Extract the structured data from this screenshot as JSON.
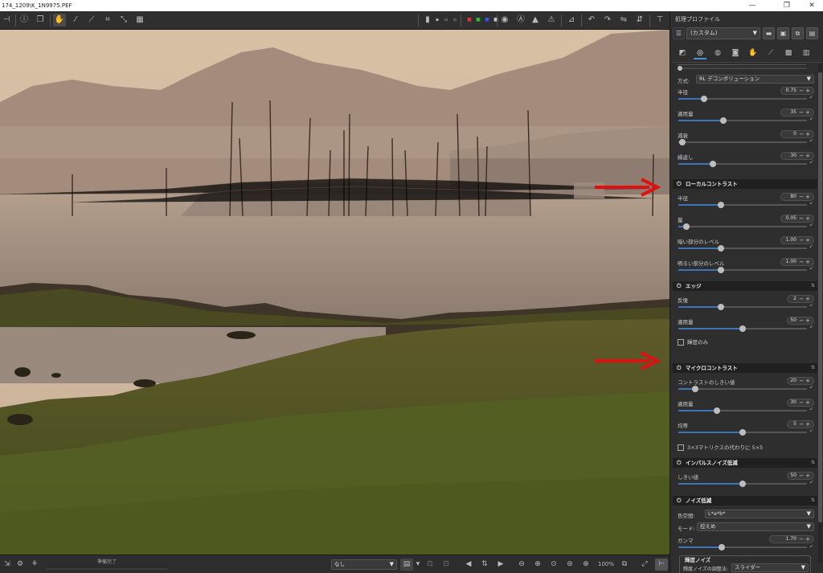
{
  "window": {
    "title": "174_1209\\K_1N9975.PEF",
    "minimize": "—",
    "maximize": "❐",
    "close": "✕"
  },
  "toolbar": {
    "icons": [
      "panel-toggle-icon",
      "info-icon",
      "compare-icon",
      "hand-icon",
      "color-picker-icon",
      "straighten-icon",
      "crop-icon",
      "resize-icon",
      "perspective-icon",
      "preview-bg-black-icon",
      "preview-bg-white-icon",
      "channel-rgb-icon",
      "focus-mask-icon",
      "shadow-clip-icon",
      "highlight-clip-icon",
      "histogram-icon",
      "rotate-left-icon",
      "rotate-right-icon",
      "flip-h-icon",
      "flip-v-icon",
      "straighten-tool-icon"
    ]
  },
  "panel": {
    "title": "処理プロファイル",
    "profile_value": "(カスタム)",
    "sections": {
      "sharpen": {
        "method_label": "方式:",
        "method_value": "RL デコンボリューション",
        "rows": [
          {
            "label": "半径",
            "value": "0.75",
            "pos": 0.2
          },
          {
            "label": "適用量",
            "value": "35",
            "pos": 0.35
          },
          {
            "label": "減衰",
            "value": "0",
            "pos": 0.03
          },
          {
            "label": "繰返し",
            "value": "30",
            "pos": 0.27
          }
        ]
      },
      "local_contrast": {
        "title": "ローカルコントラスト",
        "rows": [
          {
            "label": "半径",
            "value": "80",
            "pos": 0.33
          },
          {
            "label": "量",
            "value": "0.05",
            "pos": 0.06
          },
          {
            "label": "暗い部分のレベル",
            "value": "1.00",
            "pos": 0.33
          },
          {
            "label": "明るい部分のレベル",
            "value": "1.00",
            "pos": 0.33
          }
        ]
      },
      "edge": {
        "title": "エッジ",
        "rows": [
          {
            "label": "反復",
            "value": "2",
            "pos": 0.33
          },
          {
            "label": "適用量",
            "value": "50",
            "pos": 0.5
          }
        ],
        "checkbox_label": "輝度のみ"
      },
      "micro_contrast": {
        "title": "マイクロコントラスト",
        "rows": [
          {
            "label": "コントラストのしきい値",
            "value": "20",
            "pos": 0.13
          },
          {
            "label": "適用量",
            "value": "30",
            "pos": 0.3
          },
          {
            "label": "均等",
            "value": "5",
            "pos": 0.5
          }
        ],
        "checkbox_label": "3×3マトリクスの代わりに 5×5"
      },
      "impulse_nr": {
        "title": "インパルスノイズ低減",
        "rows": [
          {
            "label": "しきい値",
            "value": "50",
            "pos": 0.5
          }
        ]
      },
      "noise_reduction": {
        "title": "ノイズ低減",
        "color_space_label": "色空間:",
        "color_space_value": "L*a*b*",
        "mode_label": "モード:",
        "mode_value": "控えめ",
        "gamma_label": "ガンマ",
        "gamma_value": "1.70",
        "gamma_pos": 0.34,
        "luminance_title": "輝度ノイズ",
        "luminance_method_label": "輝度ノイズの調整法:",
        "luminance_method_value": "スライダー"
      }
    }
  },
  "statusbar": {
    "status_text": "準備完了",
    "combo_value": "なし",
    "zoom": "100%"
  },
  "annotations": {
    "arrow_color": "#e01010"
  }
}
